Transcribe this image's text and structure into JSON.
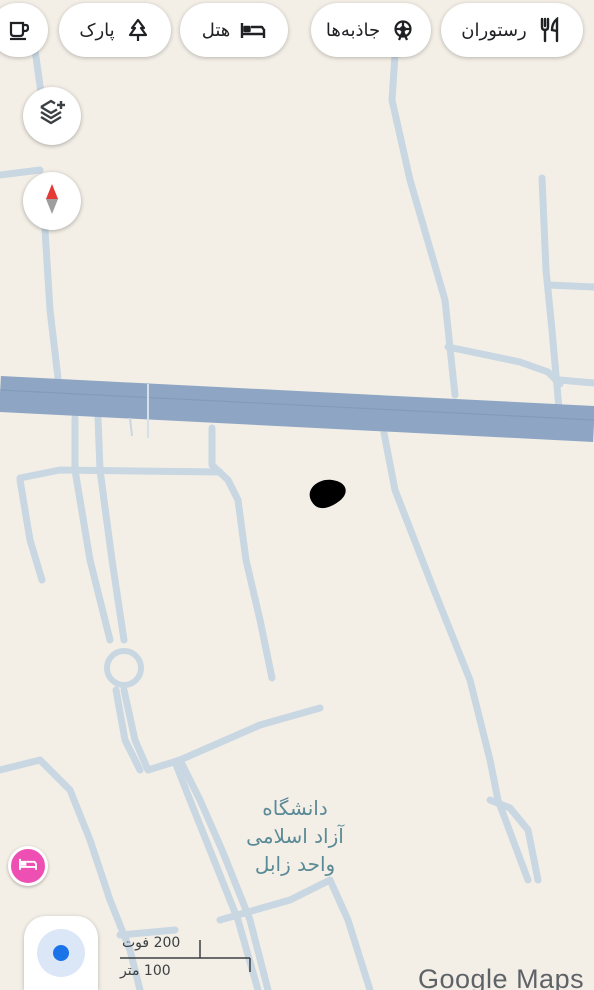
{
  "categories": [
    {
      "id": "restaurant",
      "label": "رستوران",
      "icon": "fork-knife-icon"
    },
    {
      "id": "attractions",
      "label": "جاذبه‌ها",
      "icon": "ferris-wheel-icon"
    },
    {
      "id": "hotel",
      "label": "هتل",
      "icon": "bed-icon"
    },
    {
      "id": "park",
      "label": "پارک",
      "icon": "tree-icon"
    },
    {
      "id": "cafe",
      "label": "",
      "icon": "coffee-cup-icon"
    }
  ],
  "map": {
    "place_label_lines": [
      "دانشگاه",
      "آزاد اسلامی",
      "واحد زابل"
    ],
    "scale_feet": "200 فوت",
    "scale_meters": "100 متر",
    "logo": "Google Maps",
    "colors": {
      "background": "#f3efe7",
      "minor_road": "#c8d7e2",
      "highway": "#8ea6c4",
      "place_label": "#5a8a96",
      "hotel_pin": "#ee4fb3",
      "location_dot": "#1a73e8"
    }
  },
  "controls": {
    "layers_icon": "layers-plus-icon",
    "compass_icon": "compass-icon",
    "my_location_icon": "my-location-icon"
  }
}
